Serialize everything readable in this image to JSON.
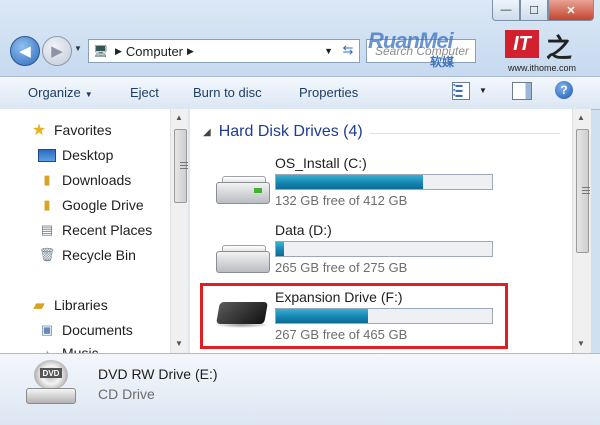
{
  "window": {
    "caption_min": "—",
    "caption_max": "☐",
    "caption_close": "✕"
  },
  "address": {
    "path": "Computer",
    "search_placeholder": "Search Computer"
  },
  "watermark": {
    "brand": "RuanMei",
    "brand_sub": "软媒",
    "ithome_logo": "IT",
    "ithome_glyph": "之",
    "ithome_url": "www.ithome.com"
  },
  "toolbar": {
    "organize": "Organize",
    "eject": "Eject",
    "burn": "Burn to disc",
    "properties": "Properties"
  },
  "navpane": {
    "favorites": "Favorites",
    "items": [
      "Desktop",
      "Downloads",
      "Google Drive",
      "Recent Places",
      "Recycle Bin"
    ],
    "libraries": "Libraries",
    "library_items": [
      "Documents",
      "Music"
    ]
  },
  "content": {
    "group_title": "Hard Disk Drives (4)",
    "drives": [
      {
        "name": "OS_Install (C:)",
        "free_text": "132 GB free of 412 GB",
        "used_fraction": 0.68
      },
      {
        "name": "Data (D:)",
        "free_text": "265 GB free of 275 GB",
        "used_fraction": 0.036
      },
      {
        "name": "Expansion Drive (F:)",
        "free_text": "267 GB free of 465 GB",
        "used_fraction": 0.426
      }
    ]
  },
  "details": {
    "name": "DVD RW Drive (E:)",
    "type": "CD Drive",
    "disc_label": "DVD"
  },
  "colors": {
    "highlight": "#e01f25",
    "bar_fill": "#1582b0",
    "group_header": "#1e3d8f"
  }
}
